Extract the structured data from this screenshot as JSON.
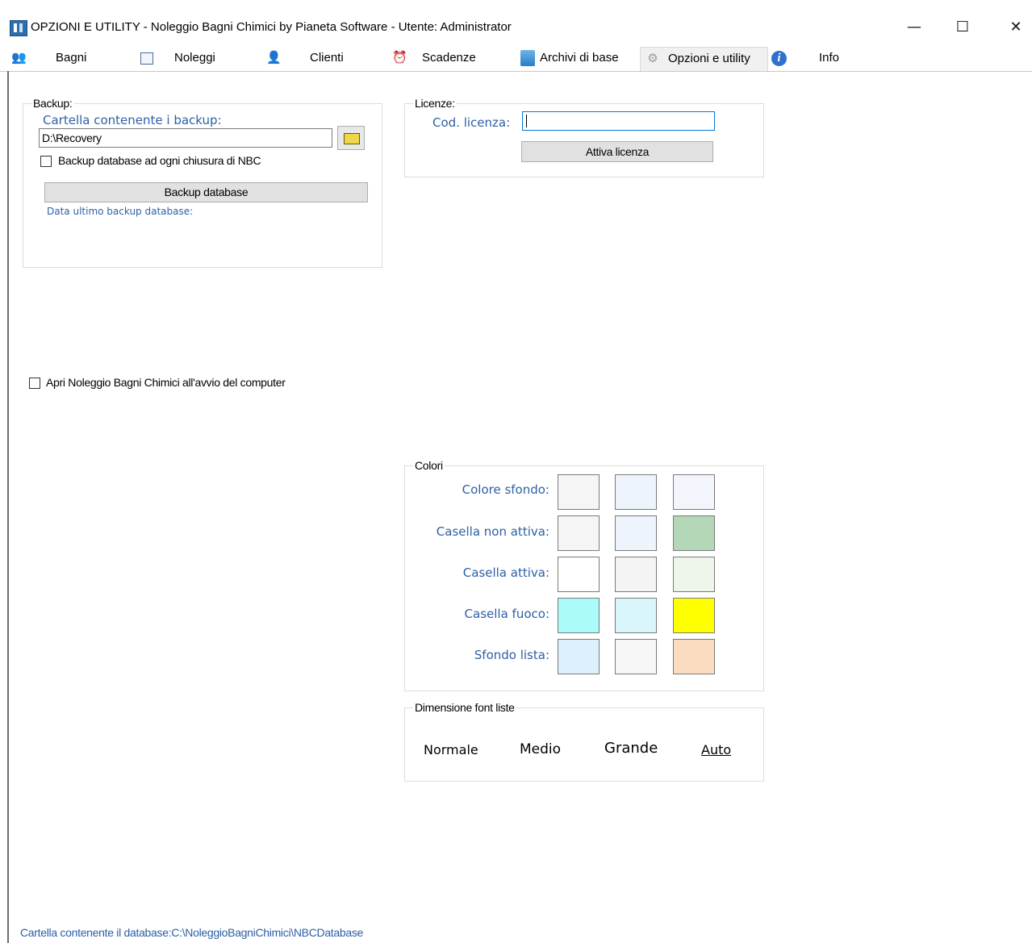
{
  "window": {
    "title": "OPZIONI E UTILITY - Noleggio Bagni Chimici by Pianeta Software - Utente: Administrator",
    "minimize": "—",
    "maximize": "☐",
    "close": "✕"
  },
  "menu": [
    {
      "label": "Bagni",
      "icon": "people-icon"
    },
    {
      "label": "Noleggi",
      "icon": "list-icon"
    },
    {
      "label": "Clienti",
      "icon": "contact-card-icon"
    },
    {
      "label": "Scadenze",
      "icon": "alarm-clock-icon"
    },
    {
      "label": "Archivi di base",
      "icon": "database-icon"
    },
    {
      "label": "Opzioni e utility",
      "icon": "gear-icon",
      "active": true
    },
    {
      "label": "Info",
      "icon": "info-icon"
    }
  ],
  "backup": {
    "group_title": "Backup:",
    "folder_label": "Cartella contenente i backup:",
    "folder_value": "D:\\Recovery",
    "checkbox_label": "Backup database ad ogni chiusura di NBC",
    "checkbox_checked": false,
    "button_label": "Backup database",
    "last_backup_label": "Data ultimo backup database:"
  },
  "license": {
    "group_title": "Licenze:",
    "code_label": "Cod. licenza:",
    "code_value": "",
    "button_label": "Attiva licenza"
  },
  "startup": {
    "checkbox_label": "Apri Noleggio Bagni Chimici all'avvio del computer",
    "checked": false
  },
  "colors": {
    "group_title": "Colori",
    "rows": [
      {
        "label": "Colore sfondo:",
        "swatches": [
          "#f5f5f5",
          "#eef4fc",
          "#f2f6fc"
        ]
      },
      {
        "label": "Casella non attiva:",
        "swatches": [
          "#f5f5f5",
          "#eef4fc",
          "#b4d7b8"
        ]
      },
      {
        "label": "Casella attiva:",
        "swatches": [
          "#ffffff",
          "#f4f4f4",
          "#eef6ec"
        ]
      },
      {
        "label": "Casella fuoco:",
        "swatches": [
          "#acfbfb",
          "#d9f6fc",
          "#ffff00"
        ]
      },
      {
        "label": "Sfondo lista:",
        "swatches": [
          "#ddf1fc",
          "#f7f7f7",
          "#fcdcc0"
        ]
      }
    ]
  },
  "font_size": {
    "group_title": "Dimensione font liste",
    "options": [
      "Normale",
      "Medio",
      "Grande",
      "Auto"
    ]
  },
  "footer": {
    "database_path": "Cartella contenente il database:C:\\NoleggioBagniChimici\\NBCDatabase"
  }
}
